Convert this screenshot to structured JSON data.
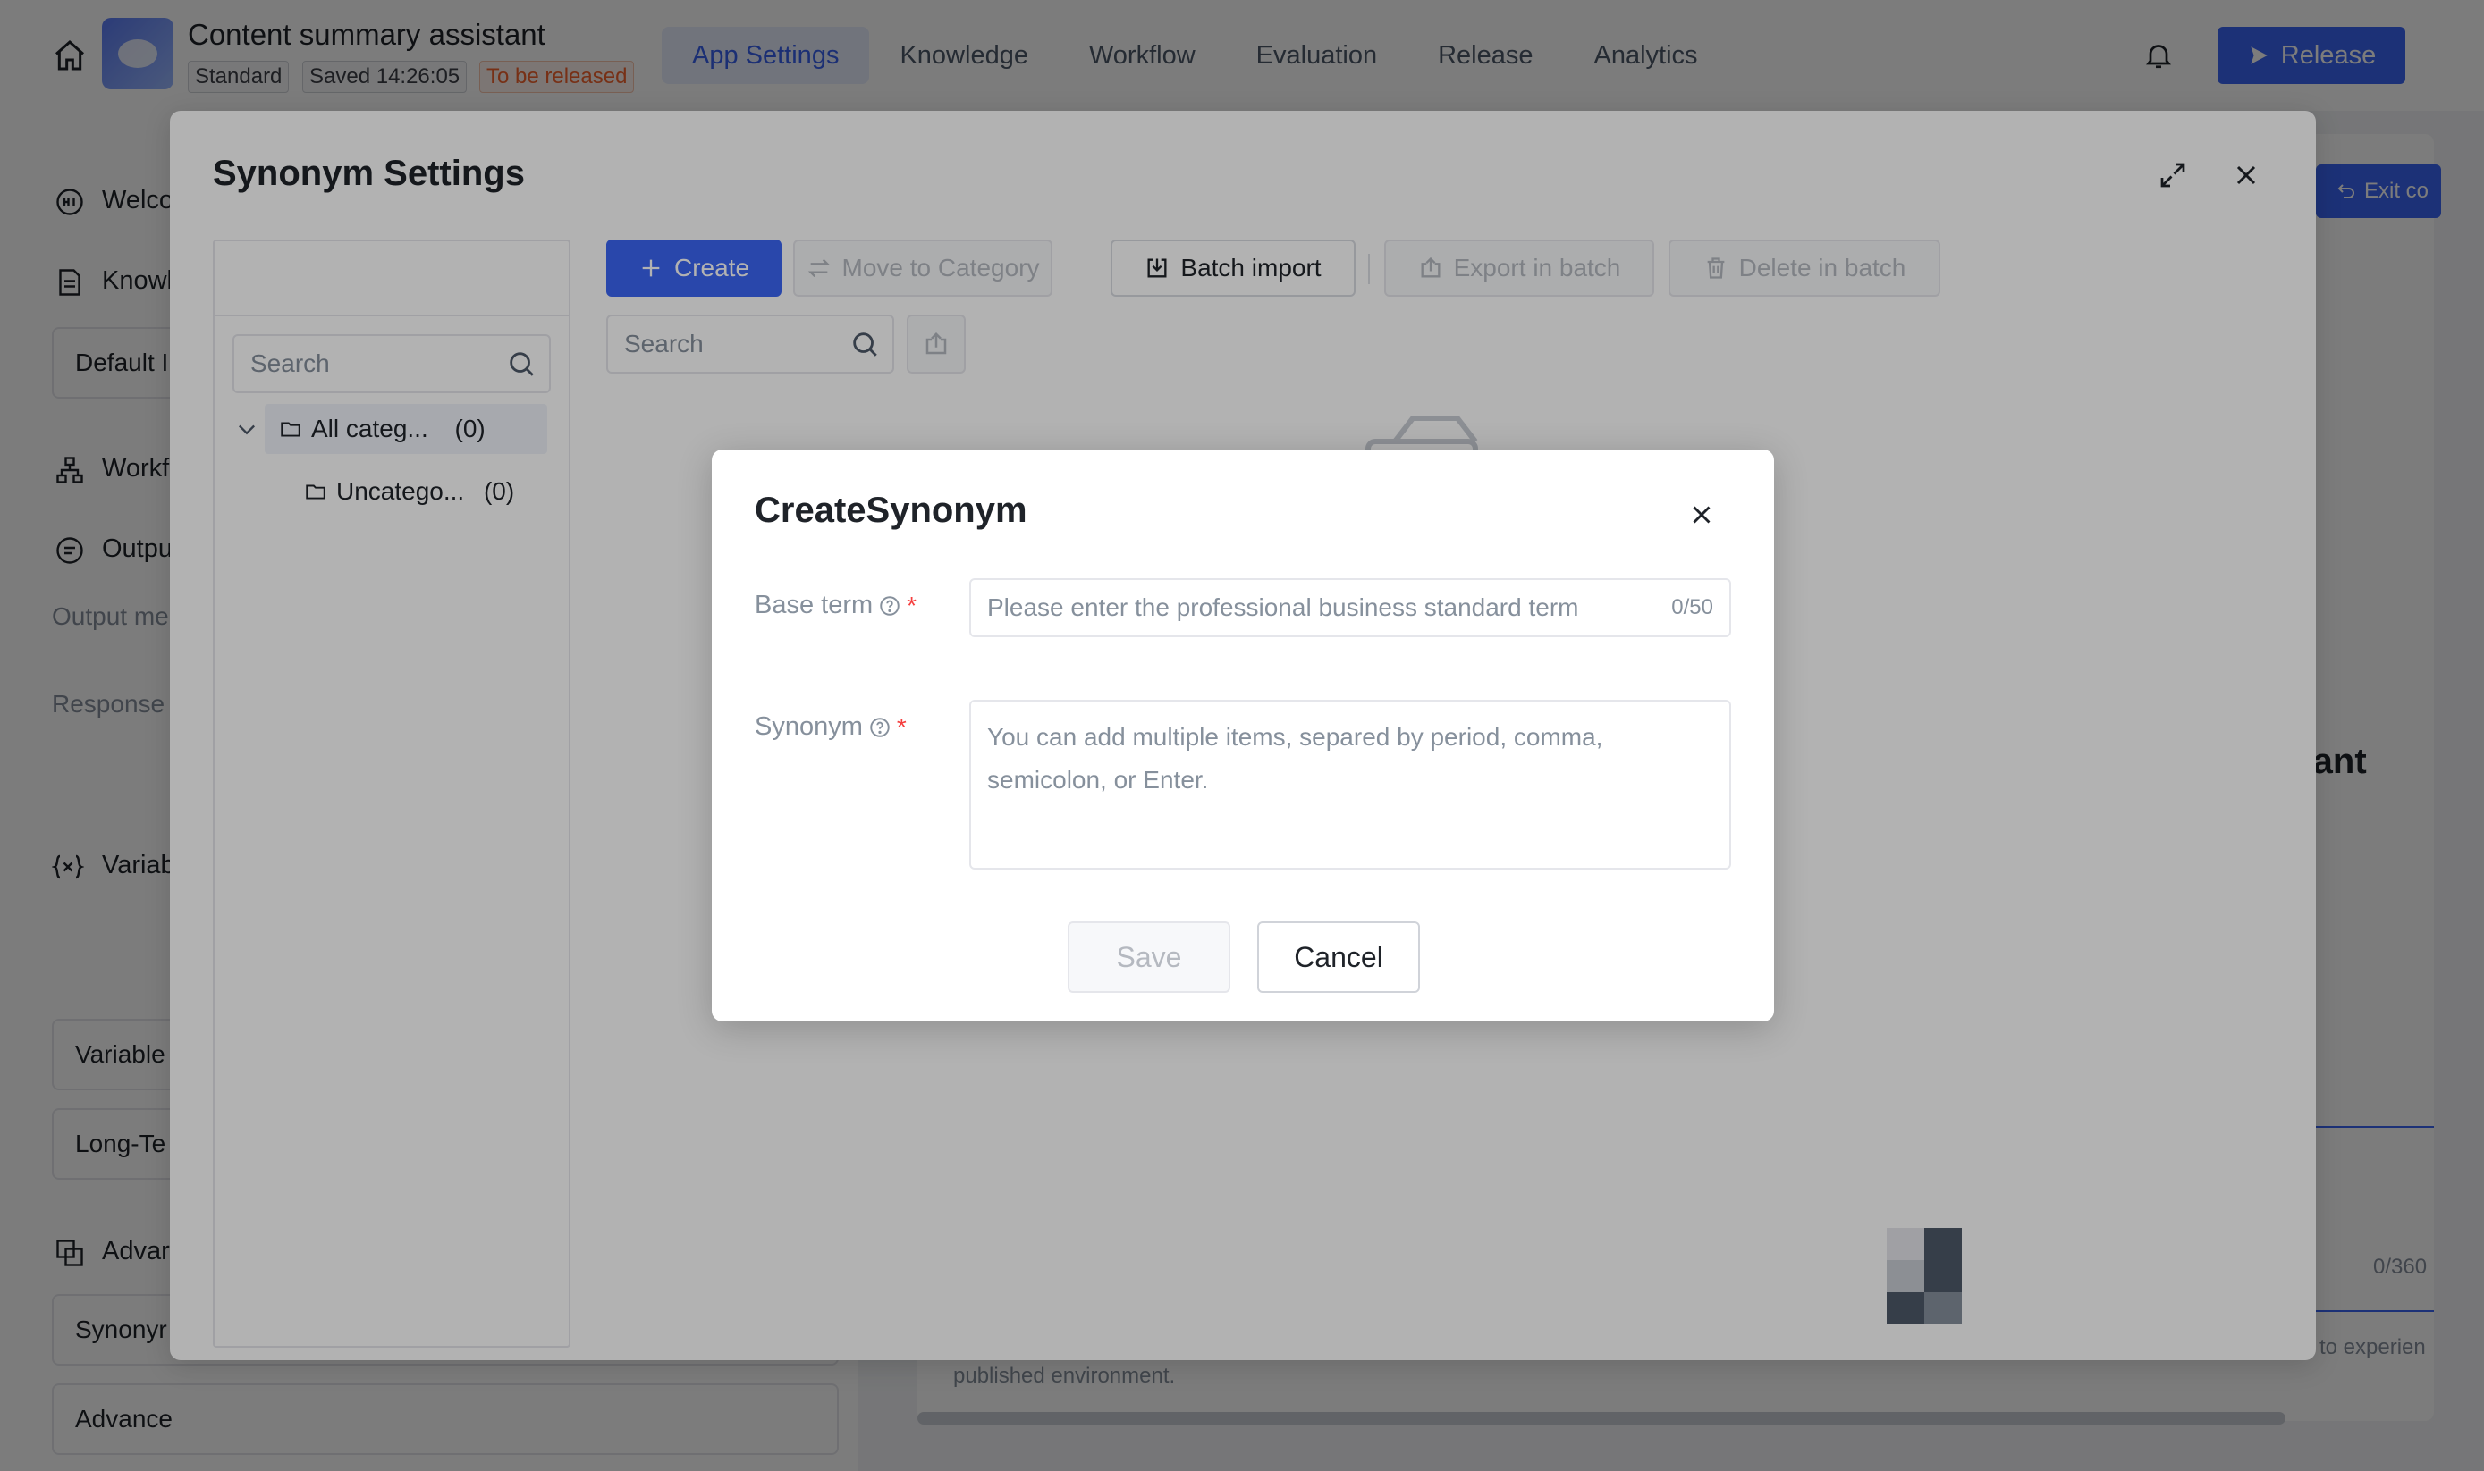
{
  "header": {
    "app_title": "Content summary assistant",
    "tags": [
      "Standard",
      "Saved 14:26:05",
      "To be released"
    ],
    "nav": [
      "App Settings",
      "Knowledge",
      "Workflow",
      "Evaluation",
      "Release",
      "Analytics"
    ],
    "active_nav": "App Settings",
    "release_label": "Release"
  },
  "sidebar": {
    "welcome": "Welco",
    "knowledge": "Knowl",
    "default_box": "Default I",
    "workflow": "Workf",
    "output": "Outpu",
    "output_method": "Output me",
    "response": "Response",
    "variables": "Variab",
    "variable_box": "Variable",
    "longterm_box": "Long-Te",
    "advanced": "Advar",
    "synonym_box": "Synonyr",
    "advanced_box": "Advance"
  },
  "right_panel": {
    "exit_label": "Exit co",
    "title_fragment": "istant",
    "count": "0/360",
    "note": "to experien",
    "published": "published environment."
  },
  "drawer": {
    "title": "Synonym Settings",
    "category_search_placeholder": "Search",
    "categories": [
      {
        "label": "All categ...",
        "count": "(0)"
      },
      {
        "label": "Uncatego...",
        "count": "(0)"
      }
    ],
    "toolbar": {
      "create": "Create",
      "move": "Move to Category",
      "batch_import": "Batch import",
      "export": "Export in batch",
      "delete": "Delete in batch"
    },
    "list_search_placeholder": "Search"
  },
  "modal": {
    "title": "CreateSynonym",
    "base_term_label": "Base term",
    "base_term_placeholder": "Please enter the professional business standard term",
    "base_term_count": "0/50",
    "synonym_label": "Synonym",
    "synonym_placeholder": "You can add multiple items, separed by period, comma, semicolon, or Enter.",
    "required_mark": "*",
    "save": "Save",
    "cancel": "Cancel"
  },
  "colors": {
    "primary": "#3b66f5",
    "required": "#f53f3f",
    "pending": "#f5652f"
  }
}
